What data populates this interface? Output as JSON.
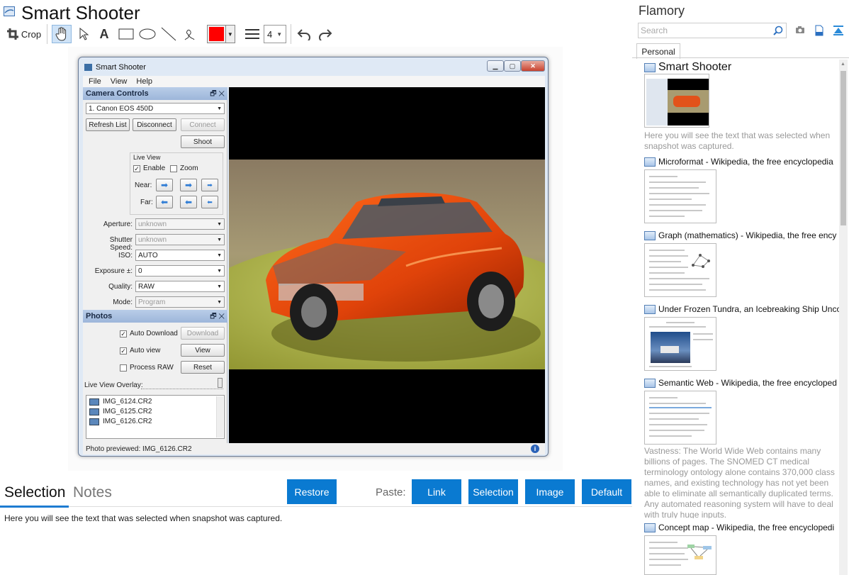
{
  "app": {
    "title": "Smart Shooter"
  },
  "toolbar": {
    "crop_label": "Crop",
    "stroke_width": "4",
    "color": "#ff0000"
  },
  "screenshot": {
    "window_title": "Smart Shooter",
    "menu": [
      "File",
      "View",
      "Help"
    ],
    "camera_controls": {
      "header": "Camera Controls",
      "camera": "1. Canon EOS 450D",
      "refresh": "Refresh List",
      "disconnect": "Disconnect",
      "connect": "Connect",
      "shoot": "Shoot",
      "live_view": "Live View",
      "enable": "Enable",
      "zoom": "Zoom",
      "near": "Near:",
      "far": "Far:",
      "aperture_label": "Aperture:",
      "aperture": "unknown",
      "shutter_label": "Shutter Speed:",
      "shutter": "unknown",
      "iso_label": "ISO:",
      "iso": "AUTO",
      "exposure_label": "Exposure ±:",
      "exposure": "0",
      "quality_label": "Quality:",
      "quality": "RAW",
      "mode_label": "Mode:",
      "mode": "Program"
    },
    "photos": {
      "header": "Photos",
      "auto_download": "Auto Download",
      "download": "Download",
      "auto_view": "Auto view",
      "view": "View",
      "process_raw": "Process RAW",
      "reset": "Reset",
      "overlay": "Live View Overlay:",
      "files": [
        "IMG_6124.CR2",
        "IMG_6125.CR2",
        "IMG_6126.CR2"
      ]
    },
    "status": "Photo previewed: IMG_6126.CR2"
  },
  "bottom": {
    "tab_selection": "Selection",
    "tab_notes": "Notes",
    "restore": "Restore",
    "paste": "Paste:",
    "link": "Link",
    "selection": "Selection",
    "image": "Image",
    "default": "Default",
    "selected_text": "Here you will see the text that was selected when snapshot was captured."
  },
  "flamory": {
    "title": "Flamory",
    "search_placeholder": "Search",
    "tab": "Personal",
    "entries": [
      {
        "title": "Smart Shooter",
        "desc": "Here you will see the text that was selected when snapshot was captured."
      },
      {
        "title": "Microformat - Wikipedia, the free encyclopedia"
      },
      {
        "title": "Graph (mathematics) - Wikipedia, the free ency"
      },
      {
        "title": "Under Frozen Tundra, an Icebreaking Ship Unco"
      },
      {
        "title": "Semantic Web - Wikipedia, the free encycloped",
        "desc": "Vastness: The World Wide Web contains many billions of pages. The SNOMED CT medical terminology ontology alone contains 370,000 class names, and existing technology has not yet been able to eliminate all semantically duplicated terms. Any automated reasoning system will have to deal with truly huge inputs."
      },
      {
        "title": "Concept map - Wikipedia, the free encyclopedi"
      }
    ]
  }
}
